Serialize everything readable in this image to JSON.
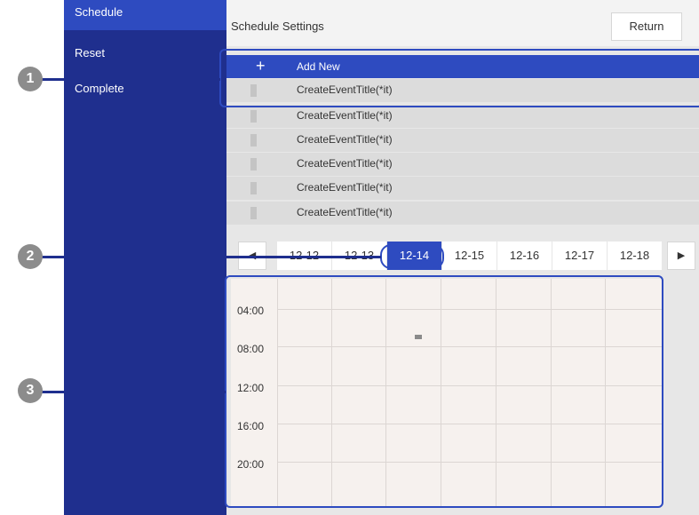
{
  "sidebar": {
    "items": [
      {
        "label": "Schedule",
        "active": true
      },
      {
        "label": "Reset",
        "active": false
      },
      {
        "label": "Complete",
        "active": false
      }
    ]
  },
  "header": {
    "title": "Schedule Settings",
    "return_label": "Return"
  },
  "list": {
    "add_new_label": "Add New",
    "add_new_icon": "+",
    "events": [
      "CreateEventTitle(*it)",
      "CreateEventTitle(*it)",
      "CreateEventTitle(*it)",
      "CreateEventTitle(*it)",
      "CreateEventTitle(*it)",
      "CreateEventTitle(*it)"
    ]
  },
  "datebar": {
    "prev_icon": "◀",
    "next_icon": "▶",
    "dates": [
      "12-12",
      "12-13",
      "12-14",
      "12-15",
      "12-16",
      "12-17",
      "12-18"
    ],
    "selected": "12-14"
  },
  "timeline": {
    "times": [
      "04:00",
      "08:00",
      "12:00",
      "16:00",
      "20:00"
    ]
  },
  "callouts": [
    "1",
    "2",
    "3"
  ],
  "colors": {
    "sidebar": "#1f2f8e",
    "accent": "#2e4bc0",
    "callout_border": "#2e4bc0"
  }
}
